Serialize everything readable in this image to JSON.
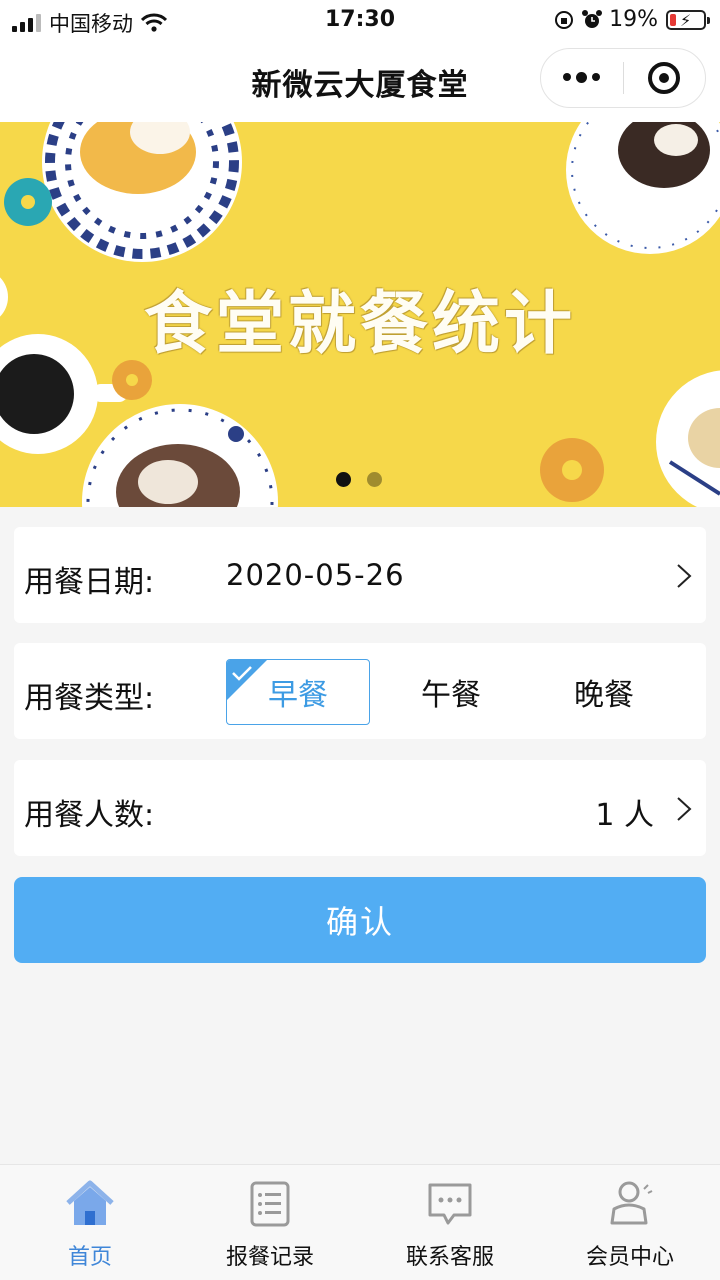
{
  "status_bar": {
    "carrier": "中国移动",
    "time": "17:30",
    "battery_percent": "19%",
    "battery_level": 0.19,
    "icons": [
      "signal-icon",
      "wifi-icon",
      "orientation-lock-icon",
      "alarm-icon",
      "battery-icon"
    ]
  },
  "nav": {
    "title": "新微云大厦食堂",
    "icons": [
      "more-dots-icon",
      "close-target-icon"
    ]
  },
  "banner": {
    "title": "食堂就餐统计",
    "slide_count": 2,
    "active_slide": 1,
    "colors": {
      "background": "#f6d84a"
    }
  },
  "form": {
    "date": {
      "label": "用餐日期:",
      "value": "2020-05-26"
    },
    "meal_type": {
      "label": "用餐类型:",
      "options": [
        "早餐",
        "午餐",
        "晚餐"
      ],
      "selected": "早餐"
    },
    "people": {
      "label": "用餐人数:",
      "value": "1 人"
    }
  },
  "confirm_button": {
    "label": "确认",
    "color": "#52adf3"
  },
  "tabbar": {
    "items": [
      {
        "label": "首页",
        "icon": "home-icon",
        "active": true
      },
      {
        "label": "报餐记录",
        "icon": "list-icon",
        "active": false
      },
      {
        "label": "联系客服",
        "icon": "chat-icon",
        "active": false
      },
      {
        "label": "会员中心",
        "icon": "user-icon",
        "active": false
      }
    ],
    "active_color": "#3f86d8"
  }
}
